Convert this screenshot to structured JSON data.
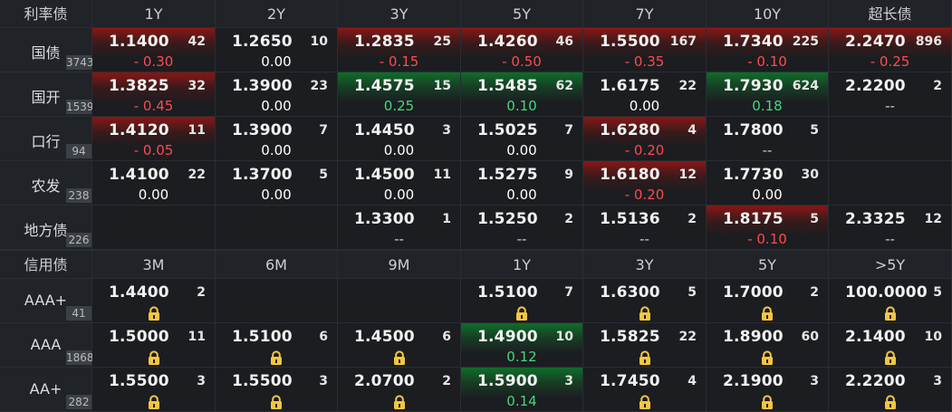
{
  "top": {
    "label": "利率债",
    "columns": [
      "1Y",
      "2Y",
      "3Y",
      "5Y",
      "7Y",
      "10Y",
      "超长债"
    ],
    "rows": [
      {
        "name": "国债",
        "count": "3743",
        "cells": [
          {
            "price": "1.1400",
            "vol": "42",
            "chg": "- 0.30",
            "tone": "red"
          },
          {
            "price": "1.2650",
            "vol": "10",
            "chg": "0.00",
            "tone": "none"
          },
          {
            "price": "1.2835",
            "vol": "25",
            "chg": "- 0.15",
            "tone": "red"
          },
          {
            "price": "1.4260",
            "vol": "46",
            "chg": "- 0.50",
            "tone": "red"
          },
          {
            "price": "1.5500",
            "vol": "167",
            "chg": "- 0.35",
            "tone": "red"
          },
          {
            "price": "1.7340",
            "vol": "225",
            "chg": "- 0.10",
            "tone": "red"
          },
          {
            "price": "2.2470",
            "vol": "896",
            "chg": "- 0.25",
            "tone": "red"
          }
        ]
      },
      {
        "name": "国开",
        "count": "1539",
        "cells": [
          {
            "price": "1.3825",
            "vol": "32",
            "chg": "- 0.45",
            "tone": "red"
          },
          {
            "price": "1.3900",
            "vol": "23",
            "chg": "0.00",
            "tone": "none"
          },
          {
            "price": "1.4575",
            "vol": "15",
            "chg": "0.25",
            "tone": "green"
          },
          {
            "price": "1.5485",
            "vol": "62",
            "chg": "0.10",
            "tone": "green"
          },
          {
            "price": "1.6175",
            "vol": "22",
            "chg": "0.00",
            "tone": "none"
          },
          {
            "price": "1.7930",
            "vol": "624",
            "chg": "0.18",
            "tone": "green"
          },
          {
            "price": "2.2200",
            "vol": "2",
            "chg": "--",
            "tone": "none"
          }
        ]
      },
      {
        "name": "口行",
        "count": "94",
        "cells": [
          {
            "price": "1.4120",
            "vol": "11",
            "chg": "- 0.05",
            "tone": "red"
          },
          {
            "price": "1.3900",
            "vol": "7",
            "chg": "0.00",
            "tone": "none"
          },
          {
            "price": "1.4450",
            "vol": "3",
            "chg": "0.00",
            "tone": "none"
          },
          {
            "price": "1.5025",
            "vol": "7",
            "chg": "0.00",
            "tone": "none"
          },
          {
            "price": "1.6280",
            "vol": "4",
            "chg": "- 0.20",
            "tone": "red"
          },
          {
            "price": "1.7800",
            "vol": "5",
            "chg": "--",
            "tone": "none"
          },
          {
            "price": "",
            "vol": "",
            "chg": "",
            "tone": "empty"
          }
        ]
      },
      {
        "name": "农发",
        "count": "238",
        "cells": [
          {
            "price": "1.4100",
            "vol": "22",
            "chg": "0.00",
            "tone": "none"
          },
          {
            "price": "1.3700",
            "vol": "5",
            "chg": "0.00",
            "tone": "none"
          },
          {
            "price": "1.4500",
            "vol": "11",
            "chg": "0.00",
            "tone": "none"
          },
          {
            "price": "1.5275",
            "vol": "9",
            "chg": "0.00",
            "tone": "none"
          },
          {
            "price": "1.6180",
            "vol": "12",
            "chg": "- 0.20",
            "tone": "red"
          },
          {
            "price": "1.7730",
            "vol": "30",
            "chg": "0.00",
            "tone": "none"
          },
          {
            "price": "",
            "vol": "",
            "chg": "",
            "tone": "empty"
          }
        ]
      },
      {
        "name": "地方债",
        "count": "226",
        "cells": [
          {
            "price": "",
            "vol": "",
            "chg": "",
            "tone": "empty"
          },
          {
            "price": "",
            "vol": "",
            "chg": "",
            "tone": "empty"
          },
          {
            "price": "1.3300",
            "vol": "1",
            "chg": "--",
            "tone": "none"
          },
          {
            "price": "1.5250",
            "vol": "2",
            "chg": "--",
            "tone": "none"
          },
          {
            "price": "1.5136",
            "vol": "2",
            "chg": "--",
            "tone": "none"
          },
          {
            "price": "1.8175",
            "vol": "5",
            "chg": "- 0.10",
            "tone": "red"
          },
          {
            "price": "2.3325",
            "vol": "12",
            "chg": "--",
            "tone": "none"
          }
        ]
      }
    ]
  },
  "bottom": {
    "label": "信用债",
    "columns": [
      "3M",
      "6M",
      "9M",
      "1Y",
      "3Y",
      "5Y",
      ">5Y"
    ],
    "rows": [
      {
        "name": "AAA+",
        "count": "41",
        "cells": [
          {
            "price": "1.4400",
            "vol": "2",
            "chg": "lock",
            "tone": "none"
          },
          {
            "price": "",
            "vol": "",
            "chg": "",
            "tone": "empty"
          },
          {
            "price": "",
            "vol": "",
            "chg": "",
            "tone": "empty"
          },
          {
            "price": "1.5100",
            "vol": "7",
            "chg": "lock",
            "tone": "none"
          },
          {
            "price": "1.6300",
            "vol": "5",
            "chg": "lock",
            "tone": "none"
          },
          {
            "price": "1.7000",
            "vol": "2",
            "chg": "lock",
            "tone": "none"
          },
          {
            "price": "100.0000",
            "vol": "5",
            "chg": "lock",
            "tone": "none"
          }
        ]
      },
      {
        "name": "AAA",
        "count": "1868",
        "cells": [
          {
            "price": "1.5000",
            "vol": "11",
            "chg": "lock",
            "tone": "none"
          },
          {
            "price": "1.5100",
            "vol": "6",
            "chg": "lock",
            "tone": "none"
          },
          {
            "price": "1.4500",
            "vol": "6",
            "chg": "lock",
            "tone": "none"
          },
          {
            "price": "1.4900",
            "vol": "10",
            "chg": "0.12",
            "tone": "green"
          },
          {
            "price": "1.5825",
            "vol": "22",
            "chg": "lock",
            "tone": "none"
          },
          {
            "price": "1.8900",
            "vol": "60",
            "chg": "lock",
            "tone": "none"
          },
          {
            "price": "2.1400",
            "vol": "10",
            "chg": "lock",
            "tone": "none"
          }
        ]
      },
      {
        "name": "AA+",
        "count": "282",
        "cells": [
          {
            "price": "1.5500",
            "vol": "3",
            "chg": "lock",
            "tone": "none"
          },
          {
            "price": "1.5500",
            "vol": "3",
            "chg": "lock",
            "tone": "none"
          },
          {
            "price": "2.0700",
            "vol": "2",
            "chg": "lock",
            "tone": "none"
          },
          {
            "price": "1.5900",
            "vol": "3",
            "chg": "0.14",
            "tone": "green"
          },
          {
            "price": "1.7450",
            "vol": "4",
            "chg": "lock",
            "tone": "none"
          },
          {
            "price": "2.1900",
            "vol": "3",
            "chg": "lock",
            "tone": "none"
          },
          {
            "price": "2.2200",
            "vol": "3",
            "chg": "lock",
            "tone": "none"
          }
        ]
      }
    ]
  },
  "colors": {
    "up": "#ff4a4a",
    "down": "#43d97b",
    "lock": "#f4c542"
  }
}
